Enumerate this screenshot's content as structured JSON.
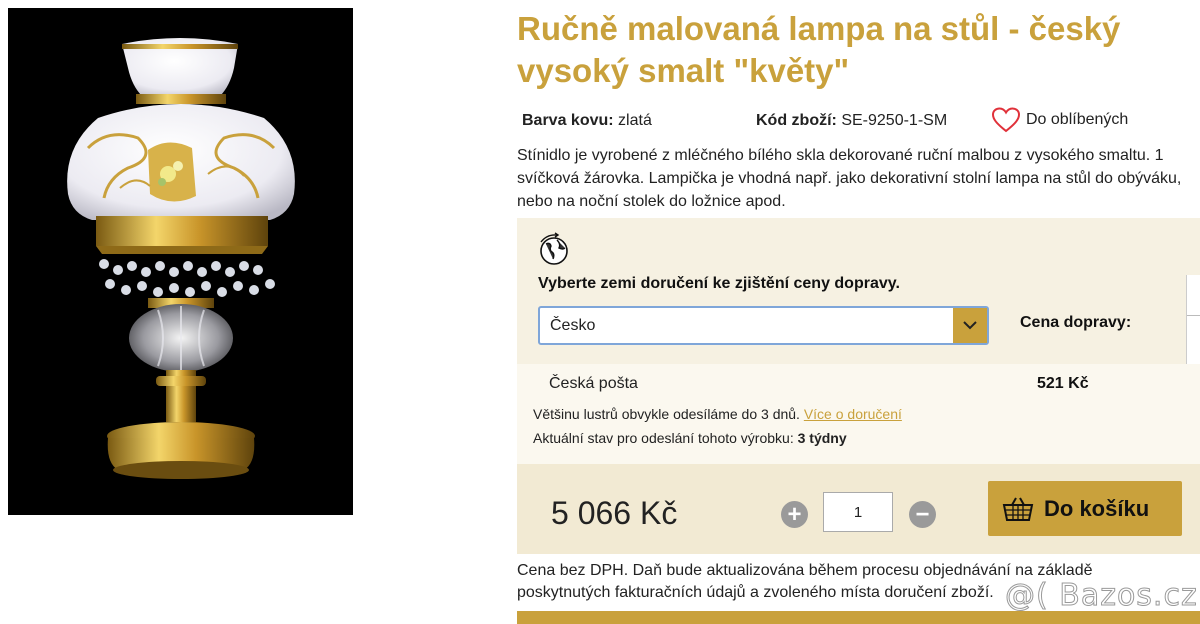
{
  "product": {
    "title": "Ručně malovaná lampa na stůl - český vysoký smalt \"květy\"",
    "metal_color_label": "Barva kovu:",
    "metal_color_value": "zlatá",
    "code_label": "Kód zboží:",
    "code_value": "SE-9250-1-SM",
    "favorite_label": "Do oblíbených",
    "description": "Stínidlo je vyrobené z mléčného bílého skla dekorované ruční malbou z vysokého smaltu. 1 svíčková žárovka. Lampička je vhodná např. jako dekorativní stolní lampa na stůl do obýváku, nebo na noční stolek do ložnice apod."
  },
  "shipping": {
    "icon": "globe-icon",
    "heading": "Vyberte zemi doručení ke zjištění ceny dopravy.",
    "country_selected": "Česko",
    "price_label": "Cena dopravy:",
    "carrier_name": "Česká pošta",
    "carrier_price": "521 Kč",
    "note_text": "Většinu lustrů obvykle odesíláme do 3 dnů.",
    "note_link": "Více o doručení",
    "status_text": "Aktuální stav pro odeslání tohoto výrobku:",
    "status_value": "3 týdny"
  },
  "purchase": {
    "price": "5 066 Kč",
    "quantity": "1",
    "plus_symbol": "+",
    "minus_symbol": "−",
    "cart_label": "Do košíku",
    "cart_icon": "basket-icon",
    "tax_note": "Cena bez DPH. Daň bude aktualizována během procesu objednávání na základě poskytnutých fakturačních údajů a zvoleného místa doručení zboží."
  },
  "watermark": "@( Bazos.cz",
  "colors": {
    "accent_gold": "#c9a13c",
    "shipping_bg": "#f6f1e2",
    "buy_bg": "#f2ead3",
    "select_border": "#7fa6d9",
    "heart": "#e0313a"
  }
}
